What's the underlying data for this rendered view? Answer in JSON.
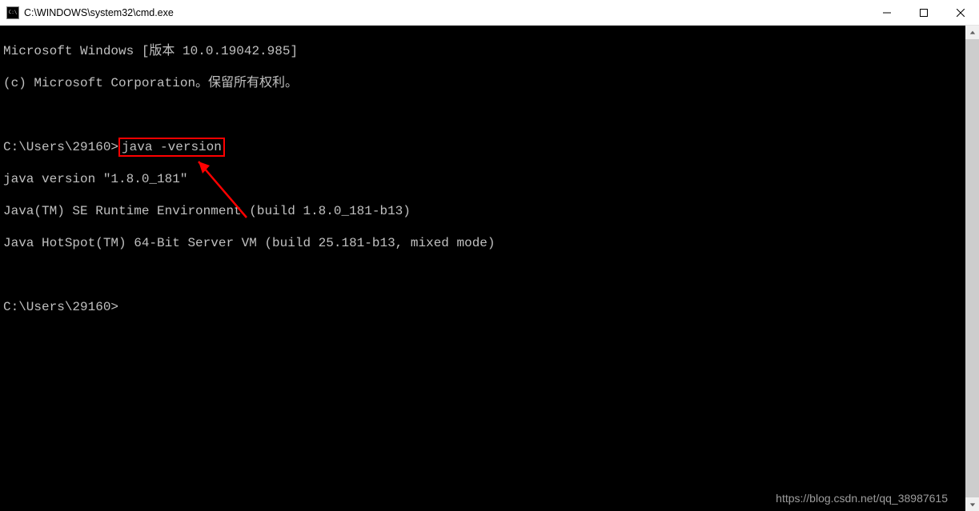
{
  "titlebar": {
    "title": "C:\\WINDOWS\\system32\\cmd.exe"
  },
  "terminal": {
    "line1": "Microsoft Windows [版本 10.0.19042.985]",
    "line2": "(c) Microsoft Corporation。保留所有权利。",
    "prompt1_prefix": "C:\\Users\\29160>",
    "prompt1_command": "java -version",
    "output1": "java version \"1.8.0_181\"",
    "output2": "Java(TM) SE Runtime Environment (build 1.8.0_181-b13)",
    "output3": "Java HotSpot(TM) 64-Bit Server VM (build 25.181-b13, mixed mode)",
    "prompt2": "C:\\Users\\29160>"
  },
  "watermark": "https://blog.csdn.net/qq_38987615"
}
